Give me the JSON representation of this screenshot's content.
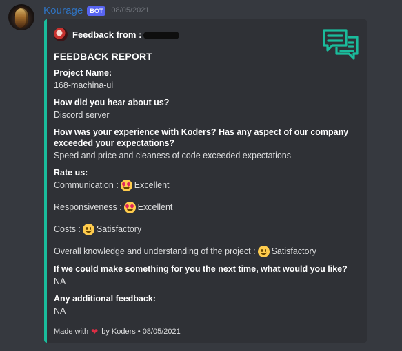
{
  "message": {
    "username": "Kourage",
    "bot_tag": "BOT",
    "timestamp": "08/05/2021"
  },
  "embed": {
    "accent_color": "#1abc9c",
    "author_name": "Feedback from :",
    "thumbnail_icon": "chat-bubbles-icon",
    "title": "FEEDBACK REPORT",
    "fields": {
      "project_name": {
        "name": "Project Name:",
        "value": "168-machina-ui"
      },
      "hear_about": {
        "name": "How did you hear about us?",
        "value": "Discord server"
      },
      "experience": {
        "name": "How was your experience with Koders? Has any aspect of our company exceeded your expectations?",
        "value": "Speed and price and cleaness of code exceeded expectations"
      },
      "rate": {
        "name": "Rate us:",
        "communication_label": "Communication :",
        "communication_value": "Excellent",
        "responsiveness_label": "Responsiveness :",
        "responsiveness_value": "Excellent",
        "costs_label": "Costs :",
        "costs_value": "Satisfactory",
        "knowledge_label": "Overall knowledge and understanding of the project :",
        "knowledge_value": "Satisfactory"
      },
      "next_time": {
        "name": "If we could make something for you the next time, what would you like?",
        "value": "NA"
      },
      "additional": {
        "name": "Any additional feedback:",
        "value": "NA"
      }
    },
    "footer": {
      "made_with": "Made with",
      "by": "by Koders • 08/05/2021"
    }
  }
}
